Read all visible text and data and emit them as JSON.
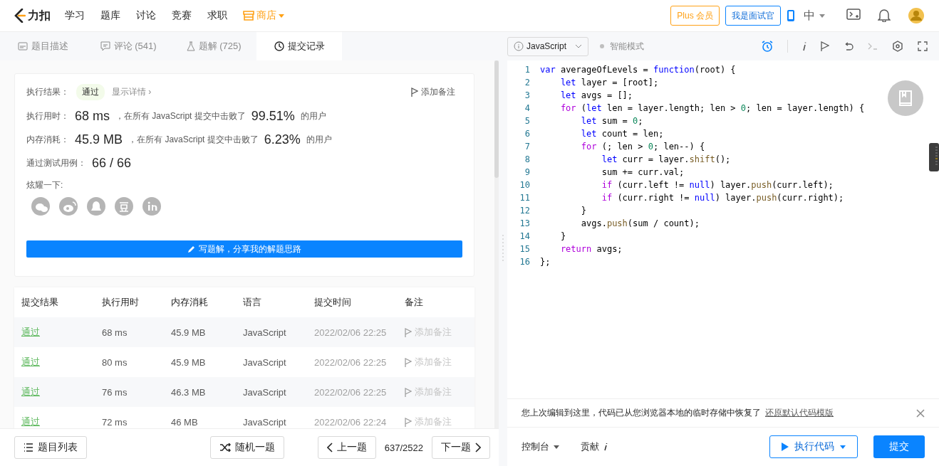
{
  "header": {
    "logo": "力扣",
    "nav": [
      {
        "label": "学习"
      },
      {
        "label": "题库"
      },
      {
        "label": "讨论"
      },
      {
        "label": "竞赛"
      },
      {
        "label": "求职"
      }
    ],
    "store": "商店",
    "plus_button": "Plus 会员",
    "interviewer_button": "我是面试官",
    "language": "中"
  },
  "left_tabs": [
    {
      "label": "题目描述",
      "kind": "description",
      "selected": false
    },
    {
      "label": "评论 (541)",
      "kind": "comments",
      "selected": false
    },
    {
      "label": "题解 (725)",
      "kind": "solutions",
      "selected": false
    },
    {
      "label": "提交记录",
      "kind": "submissions",
      "selected": true
    }
  ],
  "result": {
    "label": "执行结果：",
    "status": "通过",
    "details_link": "显示详情 ›",
    "note_link": "添加备注",
    "stats": [
      {
        "label": "执行用时：",
        "value": "68 ms",
        "text": "，在所有 JavaScript 提交中击败了",
        "percent": "99.51%",
        "suffix": "的用户"
      },
      {
        "label": "内存消耗：",
        "value": "45.9 MB",
        "text": "，在所有 JavaScript 提交中击败了",
        "percent": "6.23%",
        "suffix": "的用户"
      }
    ],
    "cases_label": "通过测试用例：",
    "cases_value": "66 / 66",
    "share_label": "炫耀一下:",
    "write_button": "写题解，分享我的解题思路"
  },
  "table": {
    "columns": [
      "提交结果",
      "执行用时",
      "内存消耗",
      "语言",
      "提交时间",
      "备注"
    ],
    "rows": [
      {
        "result": "通过",
        "runtime": "68 ms",
        "memory": "45.9 MB",
        "language": "JavaScript",
        "time": "2022/02/06 22:25",
        "note": "添加备注"
      },
      {
        "result": "通过",
        "runtime": "80 ms",
        "memory": "45.9 MB",
        "language": "JavaScript",
        "time": "2022/02/06 22:25",
        "note": "添加备注"
      },
      {
        "result": "通过",
        "runtime": "76 ms",
        "memory": "46.3 MB",
        "language": "JavaScript",
        "time": "2022/02/06 22:25",
        "note": "添加备注"
      },
      {
        "result": "通过",
        "runtime": "72 ms",
        "memory": "46 MB",
        "language": "JavaScript",
        "time": "2022/02/06 22:24",
        "note": "添加备注"
      }
    ]
  },
  "left_footer": {
    "list_button": "题目列表",
    "random_button": "随机一题",
    "prev_button": "上一题",
    "counter": "637/2522",
    "next_button": "下一题"
  },
  "editor": {
    "language": "JavaScript",
    "smart_mode": {
      "label": "智能模式",
      "on": false
    },
    "lines": [
      {
        "number": "1",
        "tokens": [
          {
            "kind": "keyword",
            "text": "var"
          },
          {
            "kind": "plain",
            "text": " averageOfLevels = "
          },
          {
            "kind": "keyword",
            "text": "function"
          },
          {
            "kind": "plain",
            "text": "(root) {"
          }
        ]
      },
      {
        "number": "2",
        "tokens": [
          {
            "kind": "keyword",
            "text": "    let"
          },
          {
            "kind": "plain",
            "text": " layer = [root];"
          }
        ]
      },
      {
        "number": "3",
        "tokens": [
          {
            "kind": "keyword",
            "text": "    let"
          },
          {
            "kind": "plain",
            "text": " avgs = [];"
          }
        ]
      },
      {
        "number": "4",
        "tokens": [
          {
            "kind": "control",
            "text": "    for"
          },
          {
            "kind": "plain",
            "text": " ("
          },
          {
            "kind": "keyword",
            "text": "let"
          },
          {
            "kind": "plain",
            "text": " len = layer.length; len > "
          },
          {
            "kind": "number",
            "text": "0"
          },
          {
            "kind": "plain",
            "text": "; len = layer.length) {"
          }
        ]
      },
      {
        "number": "5",
        "tokens": [
          {
            "kind": "keyword",
            "text": "        let"
          },
          {
            "kind": "plain",
            "text": " sum = "
          },
          {
            "kind": "number",
            "text": "0"
          },
          {
            "kind": "plain",
            "text": ";"
          }
        ]
      },
      {
        "number": "6",
        "tokens": [
          {
            "kind": "keyword",
            "text": "        let"
          },
          {
            "kind": "plain",
            "text": " count = len;"
          }
        ]
      },
      {
        "number": "7",
        "tokens": [
          {
            "kind": "control",
            "text": "        for"
          },
          {
            "kind": "plain",
            "text": " (; len > "
          },
          {
            "kind": "number",
            "text": "0"
          },
          {
            "kind": "plain",
            "text": "; len--) {"
          }
        ]
      },
      {
        "number": "8",
        "tokens": [
          {
            "kind": "keyword",
            "text": "            let"
          },
          {
            "kind": "plain",
            "text": " curr = layer."
          },
          {
            "kind": "method",
            "text": "shift"
          },
          {
            "kind": "plain",
            "text": "();"
          }
        ]
      },
      {
        "number": "9",
        "tokens": [
          {
            "kind": "plain",
            "text": "            sum += curr.val;"
          }
        ]
      },
      {
        "number": "10",
        "tokens": [
          {
            "kind": "control",
            "text": "            if"
          },
          {
            "kind": "plain",
            "text": " (curr.left != "
          },
          {
            "kind": "keyword",
            "text": "null"
          },
          {
            "kind": "plain",
            "text": ") layer."
          },
          {
            "kind": "method",
            "text": "push"
          },
          {
            "kind": "plain",
            "text": "(curr.left);"
          }
        ]
      },
      {
        "number": "11",
        "tokens": [
          {
            "kind": "control",
            "text": "            if"
          },
          {
            "kind": "plain",
            "text": " (curr.right != "
          },
          {
            "kind": "keyword",
            "text": "null"
          },
          {
            "kind": "plain",
            "text": ") layer."
          },
          {
            "kind": "method",
            "text": "push"
          },
          {
            "kind": "plain",
            "text": "(curr.right);"
          }
        ]
      },
      {
        "number": "12",
        "tokens": [
          {
            "kind": "plain",
            "text": "        }"
          }
        ]
      },
      {
        "number": "13",
        "tokens": [
          {
            "kind": "plain",
            "text": "        avgs."
          },
          {
            "kind": "method",
            "text": "push"
          },
          {
            "kind": "plain",
            "text": "(sum / count);"
          }
        ]
      },
      {
        "number": "14",
        "tokens": [
          {
            "kind": "plain",
            "text": "    }"
          }
        ]
      },
      {
        "number": "15",
        "tokens": [
          {
            "kind": "control",
            "text": "    return"
          },
          {
            "kind": "plain",
            "text": " avgs;"
          }
        ]
      },
      {
        "number": "16",
        "tokens": [
          {
            "kind": "plain",
            "text": "};"
          }
        ]
      }
    ],
    "notice": {
      "text": "您上次编辑到这里，代码已从您浏览器本地的临时存储中恢复了",
      "link": "还原默认代码模版"
    },
    "footer": {
      "console": "控制台",
      "contribute": "贡献",
      "run_button": "执行代码",
      "submit_button": "提交"
    }
  }
}
